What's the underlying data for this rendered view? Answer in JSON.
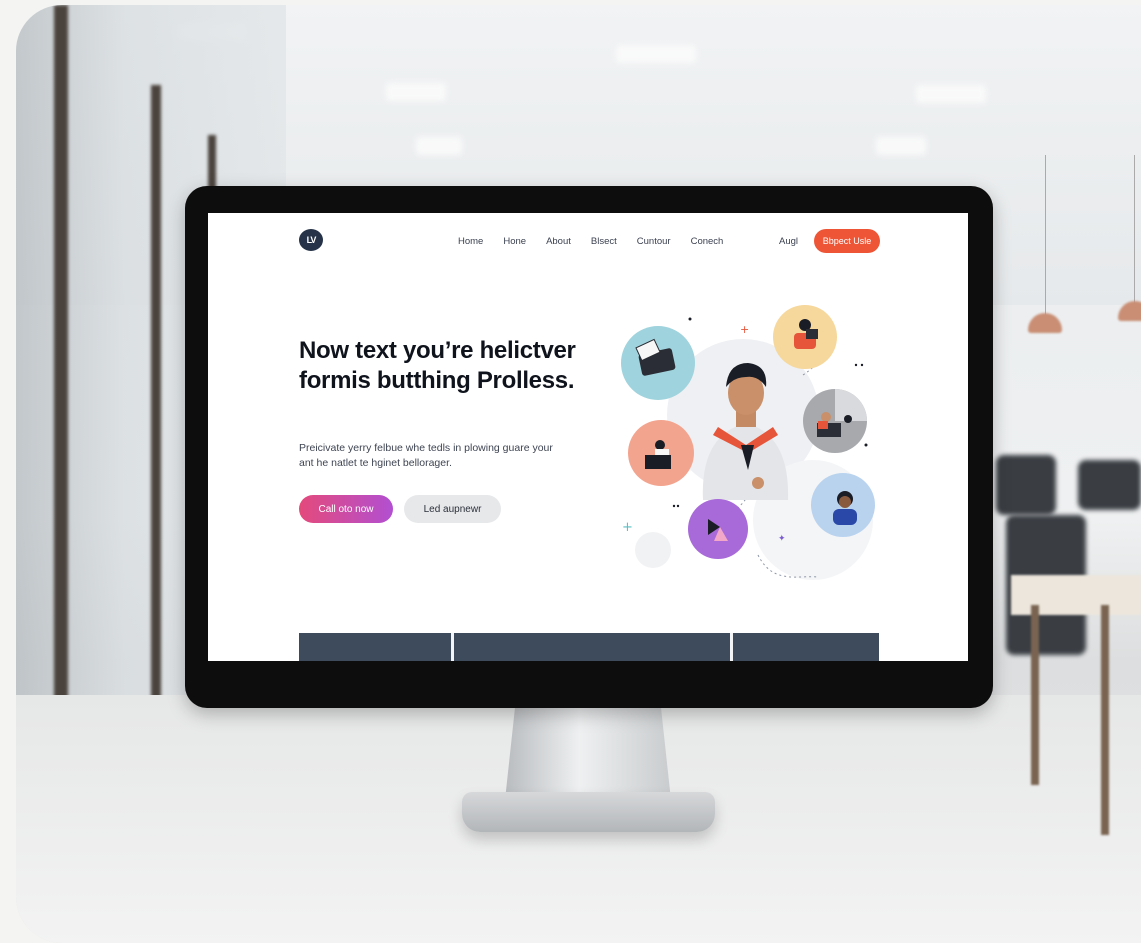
{
  "website": {
    "logo": "LV",
    "nav": {
      "links": [
        "Home",
        "Hone",
        "About",
        "Blsect",
        "Cuntour",
        "Conech"
      ],
      "secondary_link": "Augl",
      "cta": "Bbpect Usle"
    },
    "hero": {
      "title": "Now text you’re helictver formis butthing Prolless.",
      "subtitle": "Preicivate yerry felbue whe tedls in plowing guare your ant he natlet te hginet bellorager.",
      "primary_button": "Call oto now",
      "secondary_button": "Led aupnewr"
    }
  },
  "colors": {
    "cta": "#ee5536",
    "primary_gradient": [
      "#e44a7b",
      "#b24fd2"
    ],
    "dark": "#0f131c",
    "bubbles": [
      "#9fd3dd",
      "#f6d79c",
      "#a7a9ad",
      "#f3a48f",
      "#b9d3ef",
      "#a86ad9"
    ]
  }
}
